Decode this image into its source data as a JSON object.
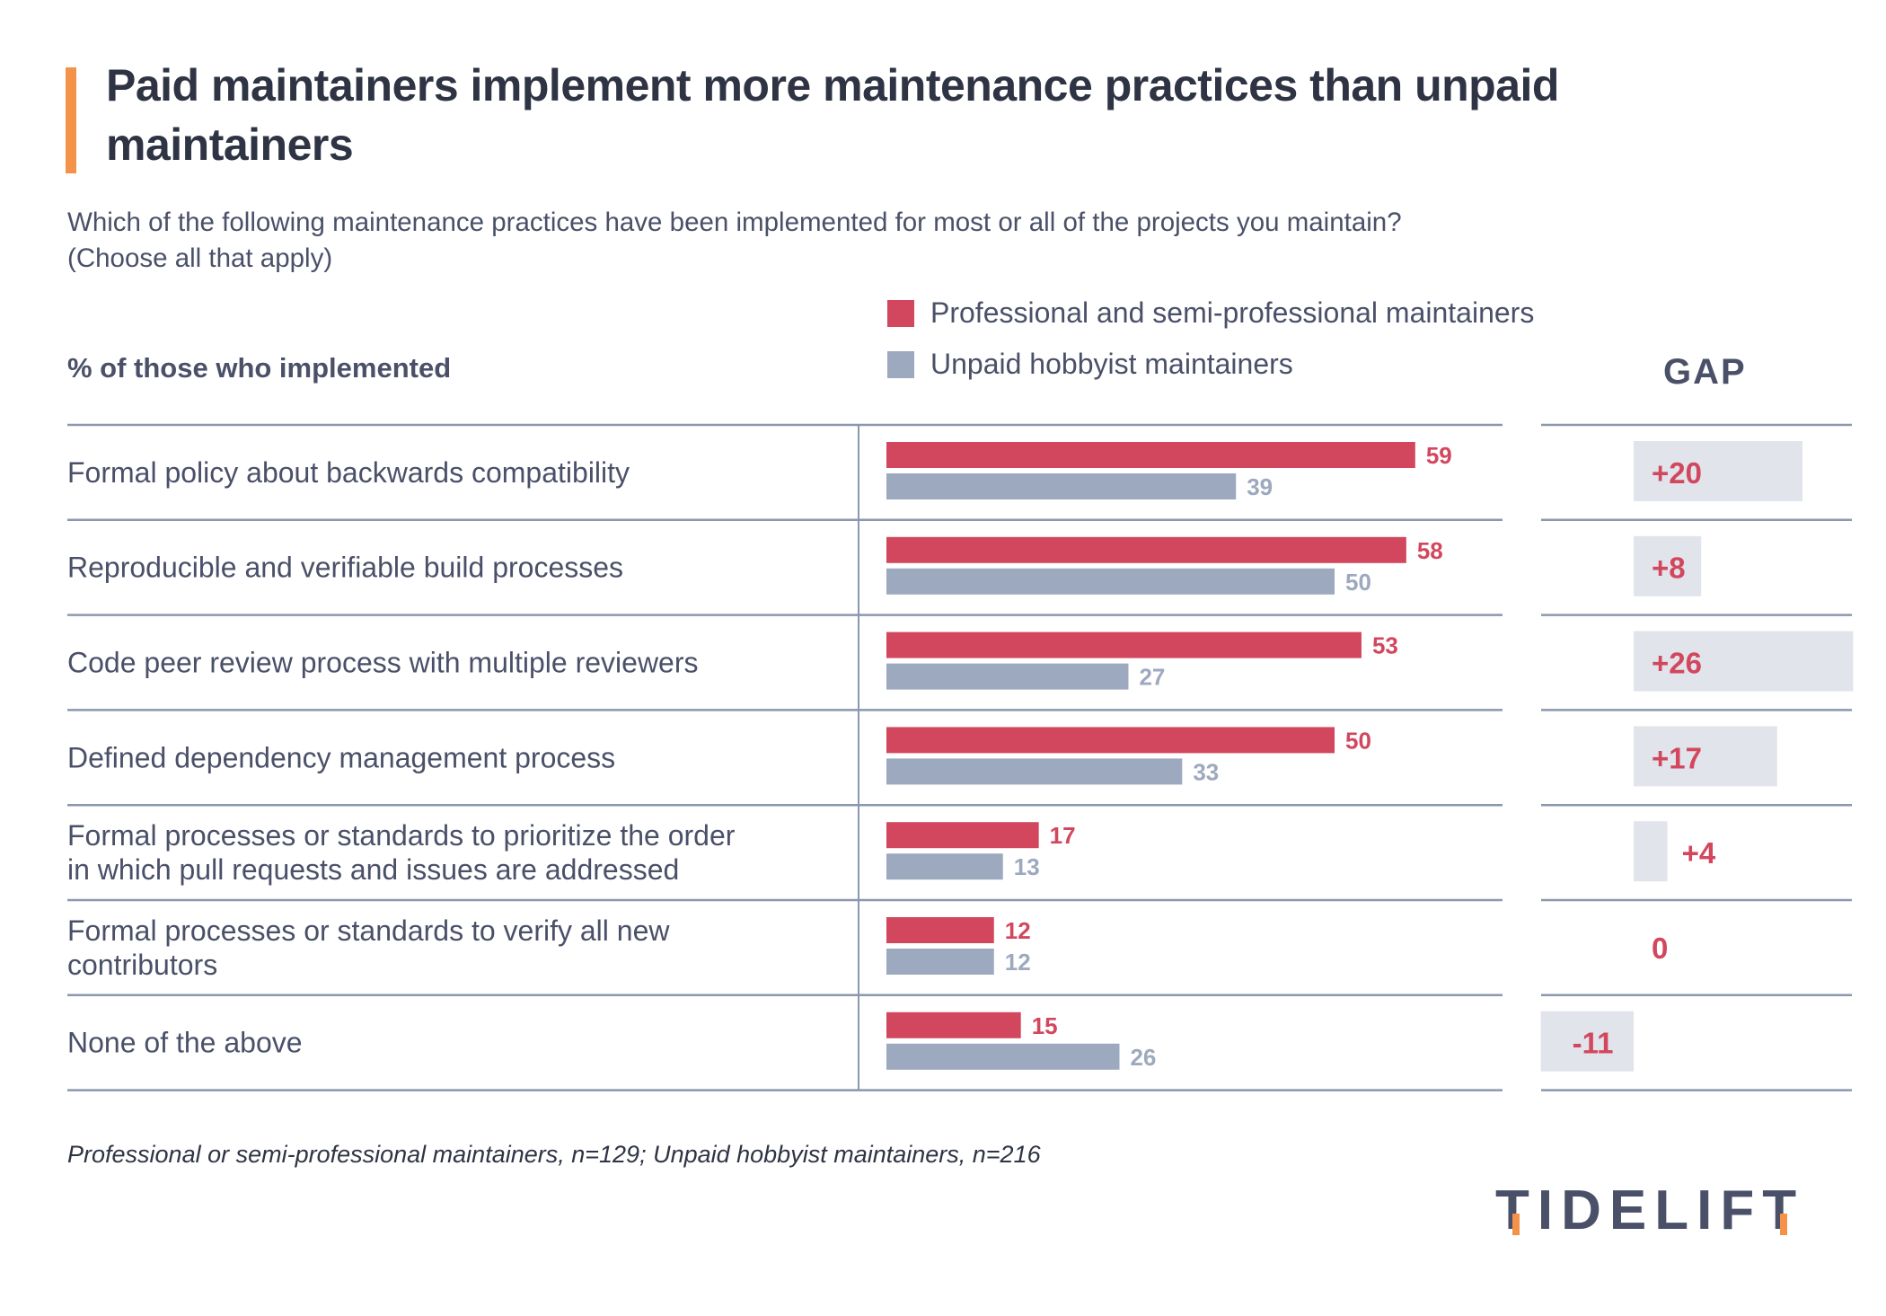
{
  "header": {
    "title": "Paid maintainers implement more maintenance practices than unpaid maintainers",
    "subtitle_line1": "Which of the following maintenance practices have been implemented for most or all of the projects you maintain?",
    "subtitle_line2": "(Choose all that apply)",
    "column_header": "% of those who implemented",
    "gap_header": "GAP"
  },
  "colors": {
    "accent": "#f4924a",
    "professional": "#d2475e",
    "hobbyist": "#9da9be",
    "gap_box": "#e1e4eb",
    "text": "#4a5068",
    "rule": "#8a97ad"
  },
  "footnote": "Professional or semi-professional maintainers, n=129; Unpaid hobbyist maintainers, n=216",
  "logo": {
    "text": "TIDELIFT"
  },
  "chart_data": {
    "type": "bar",
    "orientation": "horizontal",
    "title": "Paid maintainers implement more maintenance practices than unpaid maintainers",
    "subtitle": "Which of the following maintenance practices have been implemented for most or all of the projects you maintain? (Choose all that apply)",
    "xlabel": "% of those who implemented",
    "ylabel": "",
    "xlim": [
      0,
      60
    ],
    "grid": false,
    "legend": {
      "position": "top-right",
      "entries": [
        "Professional and semi-professional maintainers",
        "Unpaid hobbyist maintainers"
      ]
    },
    "categories": [
      [
        "Formal policy about backwards compatibility"
      ],
      [
        "Reproducible and verifiable build processes"
      ],
      [
        "Code peer review process with multiple reviewers"
      ],
      [
        "Defined dependency management process"
      ],
      [
        "Formal processes or standards to prioritize the order",
        "in which pull requests and issues are addressed"
      ],
      [
        "Formal processes or standards to verify all new",
        "contributors"
      ],
      [
        "None of the above"
      ]
    ],
    "series": [
      {
        "name": "Professional and semi-professional maintainers",
        "values": [
          59,
          58,
          53,
          50,
          17,
          12,
          15
        ]
      },
      {
        "name": "Unpaid hobbyist maintainers",
        "values": [
          39,
          50,
          27,
          33,
          13,
          12,
          26
        ]
      }
    ],
    "gap": {
      "label": "GAP",
      "values": [
        20,
        8,
        26,
        17,
        4,
        0,
        -11
      ],
      "labels": [
        "+20",
        "+8",
        "+26",
        "+17",
        "+4",
        "0",
        "-11"
      ]
    }
  }
}
